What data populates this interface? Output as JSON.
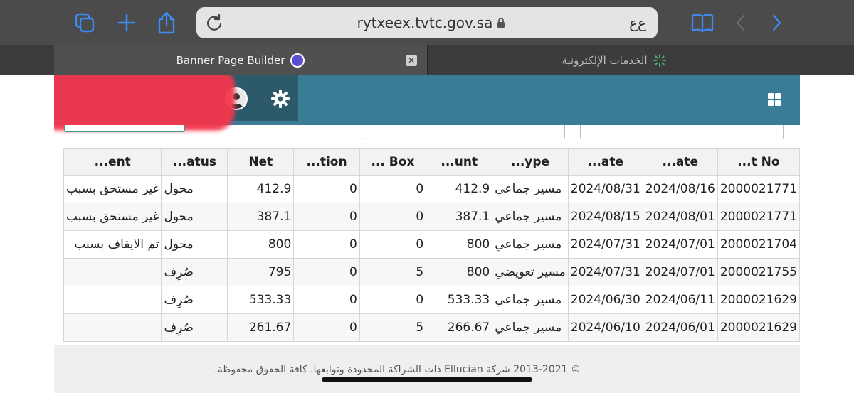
{
  "browser": {
    "url": "rytxeex.tvtc.gov.sa",
    "reader_label": "ع‌ع",
    "tabs": [
      {
        "title": "Banner Page Builder",
        "active": true
      },
      {
        "title": "الخدمات الإلكترونية",
        "active": false
      }
    ]
  },
  "table": {
    "headers": [
      "...ent",
      "...atus",
      "Net",
      "...tion",
      "... Box",
      "...unt",
      "...ype",
      "...ate",
      "...ate",
      "...t No"
    ],
    "rows": [
      [
        "غير مستحق بسبب",
        "محول",
        "412.9",
        "0",
        "0",
        "412.9",
        "مسير جماعي",
        "2024/08/31",
        "2024/08/16",
        "2000021771"
      ],
      [
        "غير مستحق بسبب",
        "محول",
        "387.1",
        "0",
        "0",
        "387.1",
        "مسير جماعي",
        "2024/08/15",
        "2024/08/01",
        "2000021771"
      ],
      [
        "تم الايقاف بسبب",
        "محول",
        "800",
        "0",
        "0",
        "800",
        "مسير جماعي",
        "2024/07/31",
        "2024/07/01",
        "2000021704"
      ],
      [
        "",
        "صُرِف",
        "795",
        "0",
        "5",
        "800",
        "مسير تعويضي",
        "2024/07/31",
        "2024/07/01",
        "2000021755"
      ],
      [
        "",
        "صُرِف",
        "533.33",
        "0",
        "0",
        "533.33",
        "مسير جماعي",
        "2024/06/30",
        "2024/06/11",
        "2000021629"
      ],
      [
        "",
        "صُرِف",
        "261.67",
        "0",
        "5",
        "266.67",
        "مسير جماعي",
        "2024/06/10",
        "2024/06/01",
        "2000021629"
      ]
    ]
  },
  "footer": {
    "copyright": "© 2013-2021 شركة Ellucian ذات الشراكة المحدودة وتوابعها. كافة الحقوق محفوظة."
  },
  "colors": {
    "toolbar": "#4b4b4b",
    "browser_accent": "#3d8bf2",
    "app_header": "#3a7c96",
    "app_header_dark": "#2d5a6b"
  },
  "icons": [
    "tabs-icon",
    "plus-icon",
    "share-icon",
    "reload-icon",
    "lock-icon",
    "bookmarks-icon",
    "back-icon",
    "forward-icon",
    "close-icon",
    "loading-spinner-icon",
    "avatar-icon",
    "gear-icon",
    "app-grid-icon"
  ]
}
